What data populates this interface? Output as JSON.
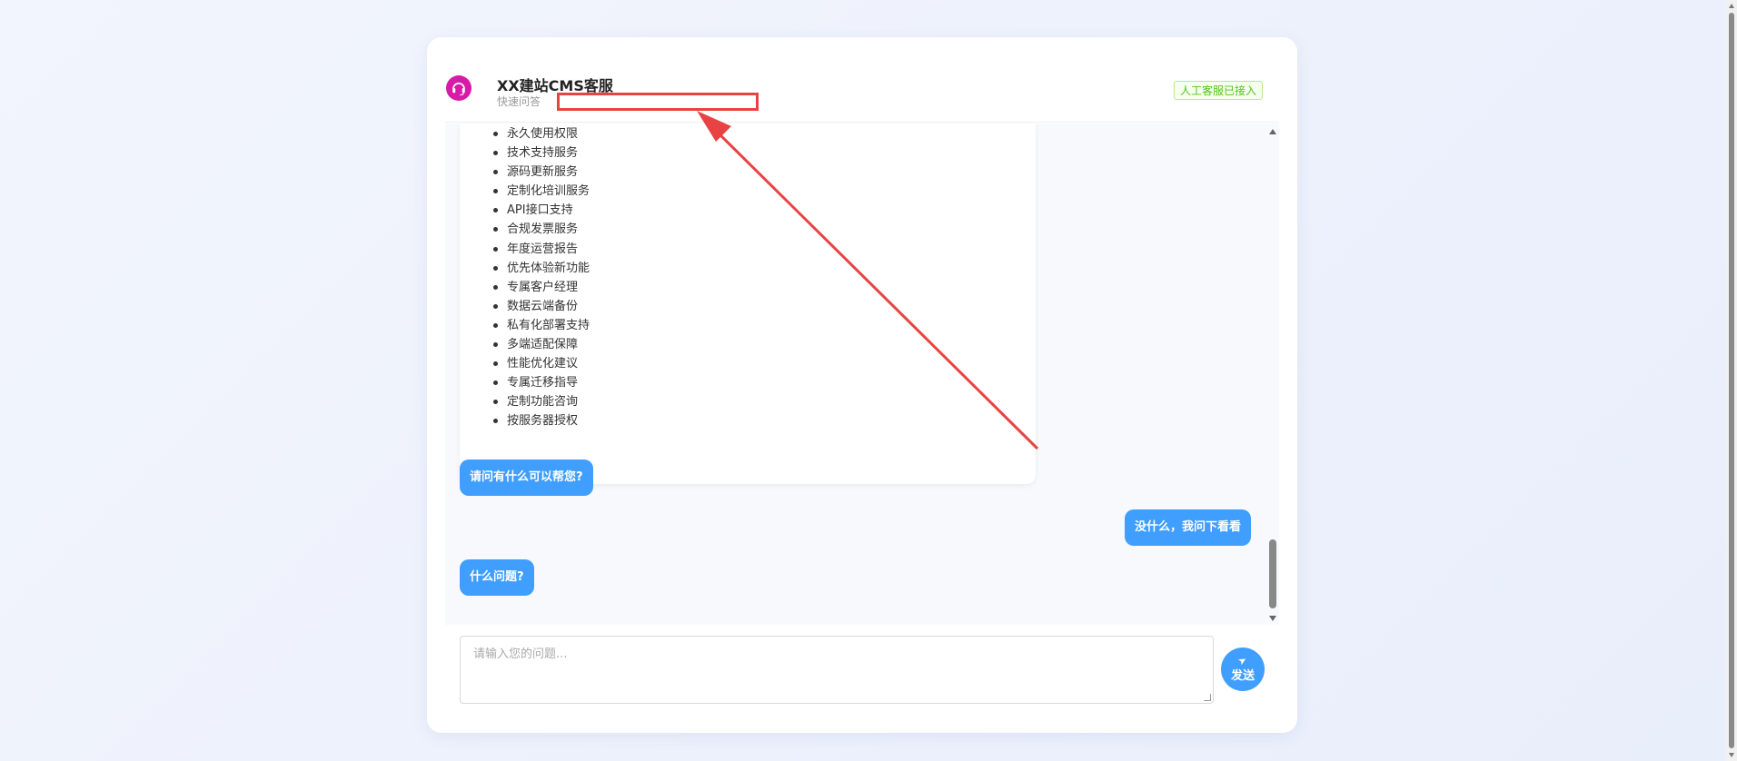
{
  "header": {
    "title": "XX建站CMS客服",
    "subtitle": "快速问答",
    "status": "人工客服已接入",
    "logo_icon": "headset-icon"
  },
  "messages": {
    "service_list": [
      "永久使用权限",
      "技术支持服务",
      "源码更新服务",
      "定制化培训服务",
      "API接口支持",
      "合规发票服务",
      "年度运营报告",
      "优先体验新功能",
      "专属客户经理",
      "数据云端备份",
      "私有化部署支持",
      "多端适配保障",
      "性能优化建议",
      "专属迁移指导",
      "定制功能咨询",
      "按服务器授权"
    ],
    "bot_greeting": "请问有什么可以帮您?",
    "user_reply": "没什么，我问下看看",
    "bot_followup": "什么问题?"
  },
  "composer": {
    "placeholder": "请输入您的问题...",
    "send_label": "发送",
    "send_icon": "paper-plane-icon"
  },
  "colors": {
    "accent": "#409eff",
    "logo": "#d81ba7",
    "status_green": "#52c41a",
    "annotation_red": "#e84343"
  }
}
